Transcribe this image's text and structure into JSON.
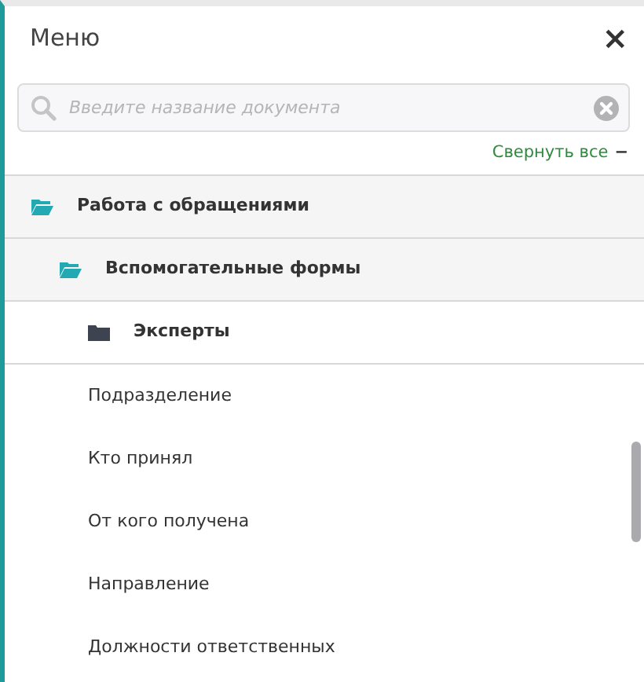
{
  "panel": {
    "title": "Меню",
    "close": "×"
  },
  "search": {
    "placeholder": "Введите название документа"
  },
  "collapse_all": {
    "label": "Свернуть все",
    "sign": "−"
  },
  "tree": [
    {
      "kind": "folder",
      "label": "Работа с обращениями",
      "expanded": true,
      "children": [
        {
          "kind": "folder",
          "label": "Вспомогательные формы",
          "expanded": true,
          "children": [
            {
              "kind": "folder",
              "label": "Эксперты",
              "expanded": false
            },
            {
              "kind": "document",
              "label": "Подразделение"
            },
            {
              "kind": "document",
              "label": "Кто принял"
            },
            {
              "kind": "document",
              "label": "От кого получена"
            },
            {
              "kind": "document",
              "label": "Направление"
            },
            {
              "kind": "document",
              "label": "Должности ответственных"
            }
          ]
        }
      ]
    }
  ]
}
